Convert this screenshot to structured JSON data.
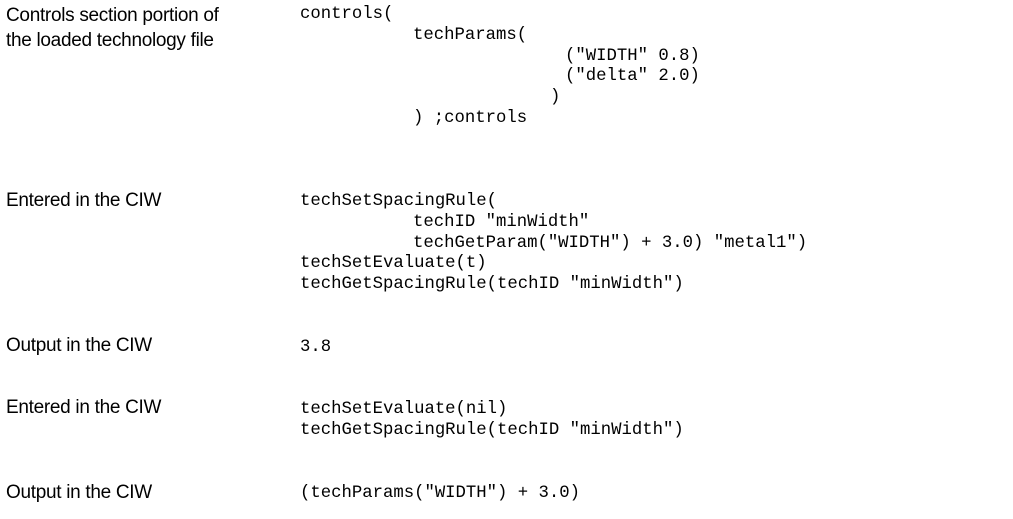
{
  "rows": [
    {
      "label": "Controls section portion of the loaded technology file",
      "code": [
        "controls(",
        "techParams(",
        "(\"WIDTH\" 0.8)",
        "(\"delta\" 2.0)",
        ")",
        ") ;controls"
      ]
    },
    {
      "label": "Entered in the CIW",
      "code": [
        "techSetSpacingRule(",
        "techID \"minWidth\"",
        "techGetParam(\"WIDTH\") + 3.0) \"metal1\")",
        "techSetEvaluate(t)",
        "techGetSpacingRule(techID \"minWidth\")"
      ]
    },
    {
      "label": "Output in the CIW",
      "code": [
        "3.8"
      ]
    },
    {
      "label": "Entered in the CIW",
      "code": [
        "techSetEvaluate(nil)",
        "techGetSpacingRule(techID \"minWidth\")"
      ]
    },
    {
      "label": "Output in the CIW",
      "code": [
        "(techParams(\"WIDTH\") + 3.0)"
      ]
    }
  ]
}
